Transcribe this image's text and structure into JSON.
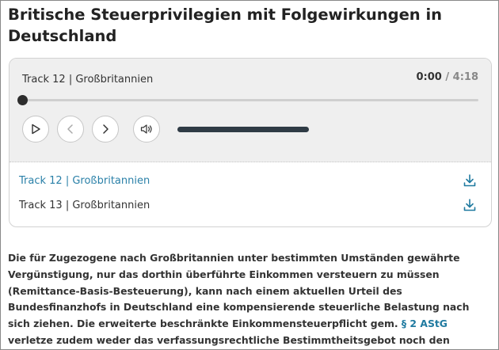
{
  "article": {
    "title": "Britische Steuerprivilegien mit Folgewirkungen in Deutschland",
    "paragraph_part1": "Die für Zugezogene nach Großbritannien unter bestimmten Umständen gewährte Vergünstigung, nur das dorthin überführte Einkommen versteuern zu müssen (Remittance-Basis-Besteuerung), kann nach einem aktuellen Urteil des Bundesfinanzhofs in Deutschland eine kompensierende steuerliche Belastung nach sich ziehen. Die erweiterte beschränkte Einkommensteuerpflicht gem. ",
    "law_link": "§ 2 AStG",
    "paragraph_part2": " verletze zudem weder das verfassungsrechtliche Bestimmtheitsgebot noch den allgemeinen Gleichheitssatz."
  },
  "player": {
    "current_track": "Track 12 | Großbritannien",
    "time_current": "0:00",
    "time_separator": " / ",
    "time_total": "4:18",
    "progress": 0.0,
    "volume": 1.0,
    "icons": {
      "play": "play-icon",
      "previous": "chevron-left-icon",
      "next": "chevron-right-icon",
      "volume": "speaker-icon",
      "download": "download-icon"
    },
    "colors": {
      "accent": "#1f7aa0",
      "panel_bg": "#efefef",
      "volume_fill": "#2f3b45"
    }
  },
  "playlist": [
    {
      "label": "Track 12 | Großbritannien",
      "active": true
    },
    {
      "label": "Track 13 | Großbritannien",
      "active": false
    }
  ]
}
